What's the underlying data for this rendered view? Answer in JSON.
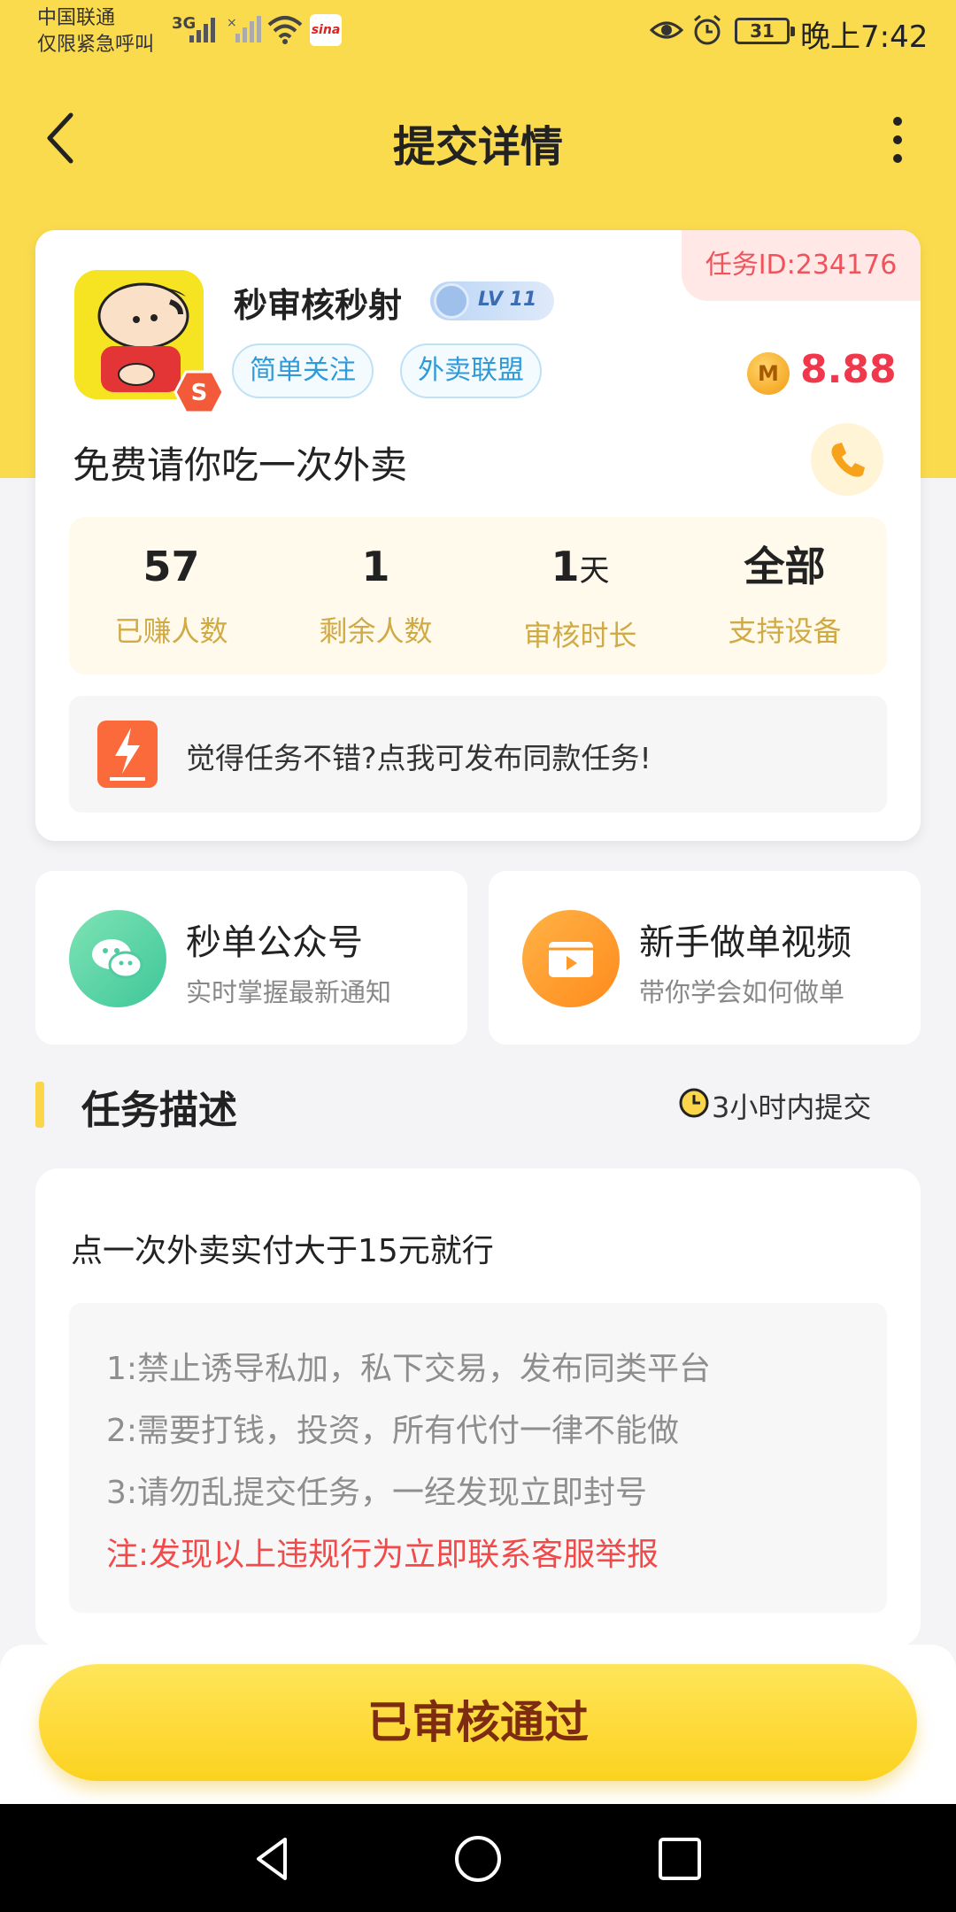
{
  "status_bar": {
    "carrier_line1": "中国联通",
    "carrier_line2": "仅限紧急呼叫",
    "network": "3G",
    "battery": "31",
    "time": "晚上7:42"
  },
  "header": {
    "title": "提交详情"
  },
  "task": {
    "id_label": "任务ID:234176",
    "shop_name": "秒审核秒射",
    "level": "LV 11",
    "tags": [
      "简单关注",
      "外卖联盟"
    ],
    "reward": "8.88",
    "coin_symbol": "M",
    "title": "免费请你吃一次外卖",
    "stats": [
      {
        "value": "57",
        "unit": "",
        "label": "已赚人数"
      },
      {
        "value": "1",
        "unit": "",
        "label": "剩余人数"
      },
      {
        "value": "1",
        "unit": "天",
        "label": "审核时长"
      },
      {
        "value": "全部",
        "unit": "",
        "label": "支持设备"
      }
    ],
    "publish_text": "觉得任务不错?点我可发布同款任务!"
  },
  "shortcuts": [
    {
      "title": "秒单公众号",
      "subtitle": "实时掌握最新通知",
      "icon": "wechat-icon"
    },
    {
      "title": "新手做单视频",
      "subtitle": "带你学会如何做单",
      "icon": "video-icon"
    }
  ],
  "description": {
    "section_title": "任务描述",
    "deadline": "3小时内提交",
    "main_text": "点一次外卖实付大于15元就行",
    "rules": [
      "1:禁止诱导私加，私下交易，发布同类平台",
      "2:需要打钱，投资，所有代付一律不能做",
      "3:请勿乱提交任务，一经发现立即封号"
    ],
    "warning": "注:发现以上违规行为立即联系客服举报"
  },
  "bottom": {
    "button_label": "已审核通过"
  },
  "colors": {
    "brand_yellow": "#fbdb4e",
    "reward_red": "#f0384c",
    "stat_label": "#d0aa45",
    "tag_blue": "#2f9ad8"
  }
}
